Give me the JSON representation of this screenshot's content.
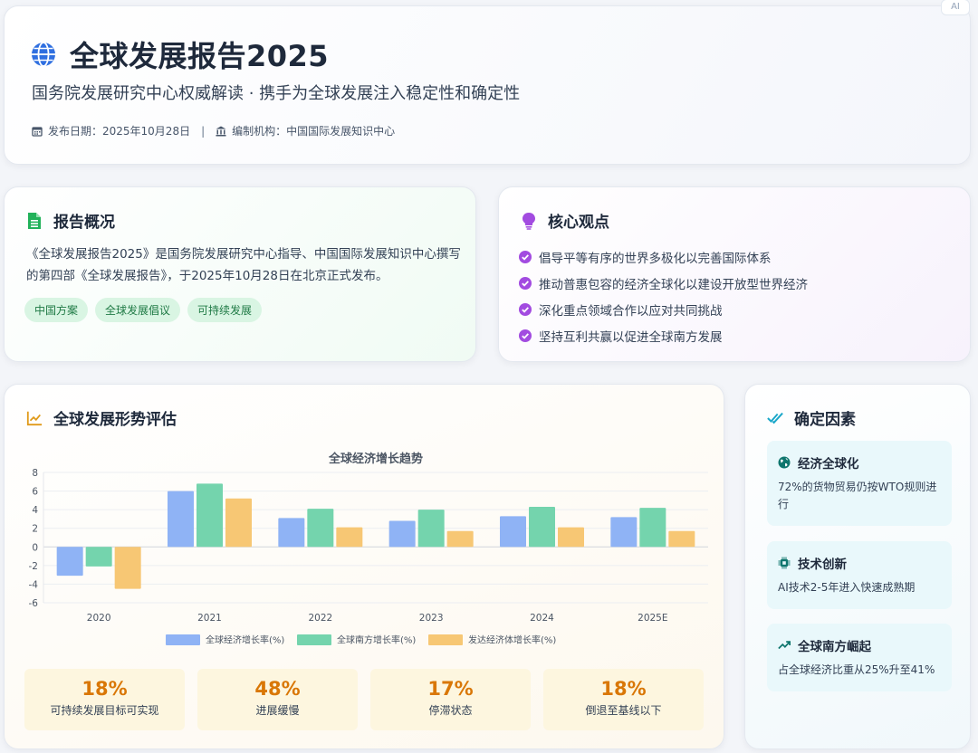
{
  "header": {
    "title": "全球发展报告2025",
    "subtitle": "国务院发展研究中心权威解读 · 携手为全球发展注入稳定性和确定性",
    "date_label": "发布日期：2025年10月28日",
    "separator": "|",
    "org_label": "编制机构：中国国际发展知识中心",
    "badge": "AI"
  },
  "overview": {
    "title": "报告概况",
    "text": "《全球发展报告2025》是国务院发展研究中心指导、中国国际发展知识中心撰写的第四部《全球发展报告》，于2025年10月28日在北京正式发布。",
    "tags": [
      "中国方案",
      "全球发展倡议",
      "可持续发展"
    ]
  },
  "core": {
    "title": "核心观点",
    "points": [
      "倡导平等有序的世界多极化以完善国际体系",
      "推动普惠包容的经济全球化以建设开放型世界经济",
      "深化重点领域合作以应对共同挑战",
      "坚持互利共赢以促进全球南方发展"
    ]
  },
  "trend": {
    "title": "全球发展形势评估",
    "stats": [
      {
        "pct": "18%",
        "label": "可持续发展目标可实现"
      },
      {
        "pct": "48%",
        "label": "进展缓慢"
      },
      {
        "pct": "17%",
        "label": "停滞状态"
      },
      {
        "pct": "18%",
        "label": "倒退至基线以下"
      }
    ]
  },
  "chart_data": {
    "type": "bar",
    "title": "全球经济增长趋势",
    "categories": [
      "2020",
      "2021",
      "2022",
      "2023",
      "2024",
      "2025E"
    ],
    "series": [
      {
        "name": "全球经济增长率(%)",
        "color": "#8fb3f5",
        "values": [
          -3.1,
          6.0,
          3.1,
          2.8,
          3.3,
          3.2
        ]
      },
      {
        "name": "全球南方增长率(%)",
        "color": "#74d4ad",
        "values": [
          -2.1,
          6.8,
          4.1,
          4.0,
          4.3,
          4.2
        ]
      },
      {
        "name": "发达经济体增长率(%)",
        "color": "#f7c774",
        "values": [
          -4.5,
          5.2,
          2.1,
          1.7,
          2.1,
          1.7
        ]
      }
    ],
    "yticks": [
      "8",
      "6",
      "4",
      "2",
      "0",
      "-2",
      "-4",
      "-6"
    ],
    "ylim": [
      -6,
      8
    ],
    "grid": true,
    "legend": "bottom"
  },
  "factors": {
    "title": "确定因素",
    "items": [
      {
        "icon": "globe-icon",
        "title": "经济全球化",
        "desc": "72%的货物贸易仍按WTO规则进行"
      },
      {
        "icon": "chip-icon",
        "title": "技术创新",
        "desc": "AI技术2-5年进入快速成熟期"
      },
      {
        "icon": "trend-up-icon",
        "title": "全球南方崛起",
        "desc": "占全球经济比重从25%升至41%"
      }
    ]
  }
}
